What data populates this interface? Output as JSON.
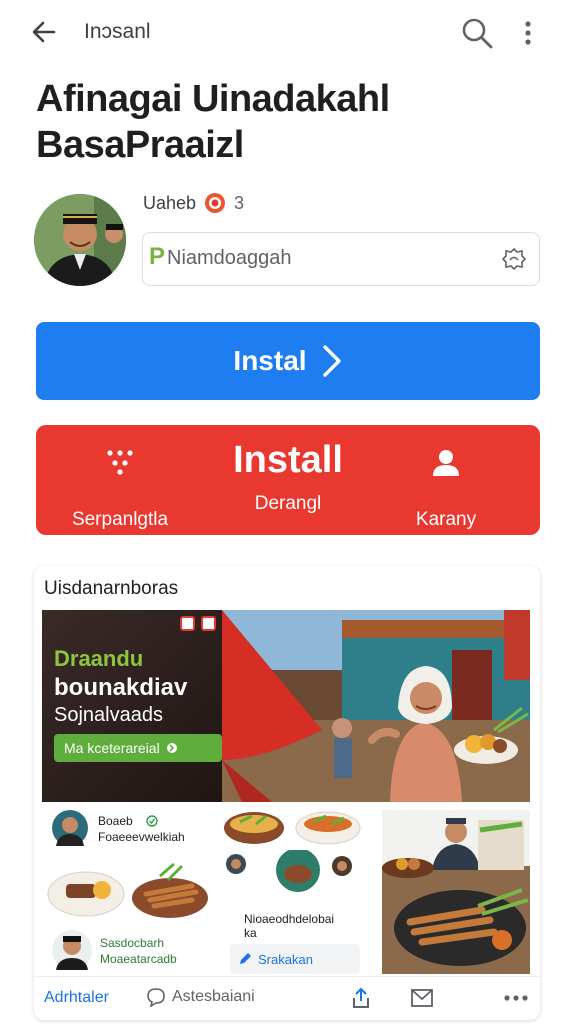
{
  "topbar": {
    "title": "Inɔsanl",
    "back_icon": "back-arrow-icon",
    "search_icon": "search-icon",
    "more_icon": "more-vert-icon"
  },
  "app": {
    "title": "Afinagai Uinadakahl BasaPraaizl"
  },
  "developer": {
    "name": "Uaheb",
    "count": "3"
  },
  "field": {
    "prefix": "P",
    "value": "Niamdoaggah"
  },
  "primary_button": {
    "label": "Instal",
    "color": "#1f7df2"
  },
  "install_button": {
    "label": "Install",
    "color": "#e8382f",
    "left_label": "Serpanlgtla",
    "middle_label": "Derangl",
    "right_label": "Karany"
  },
  "card": {
    "title": "Uisdanarnboras",
    "hero": {
      "line1": "Draandu",
      "line2": "bounakdiav",
      "line3": "Sojnalvaads",
      "pill": "Ma kceterareial"
    },
    "tiles": {
      "t1_name1": "Boaeb",
      "t1_sub1": "Foaeeevwelkiah",
      "t1_name2": "Sasdocbarh",
      "t1_sub2": "Moaeatarcadb",
      "t2_caption1": "Nioaeodhdelobai",
      "t2_caption2": "ka",
      "t2_link": "Srakakan"
    },
    "bottombar": {
      "first": "Adrhtaler",
      "chat": "Astesbaiani"
    }
  }
}
